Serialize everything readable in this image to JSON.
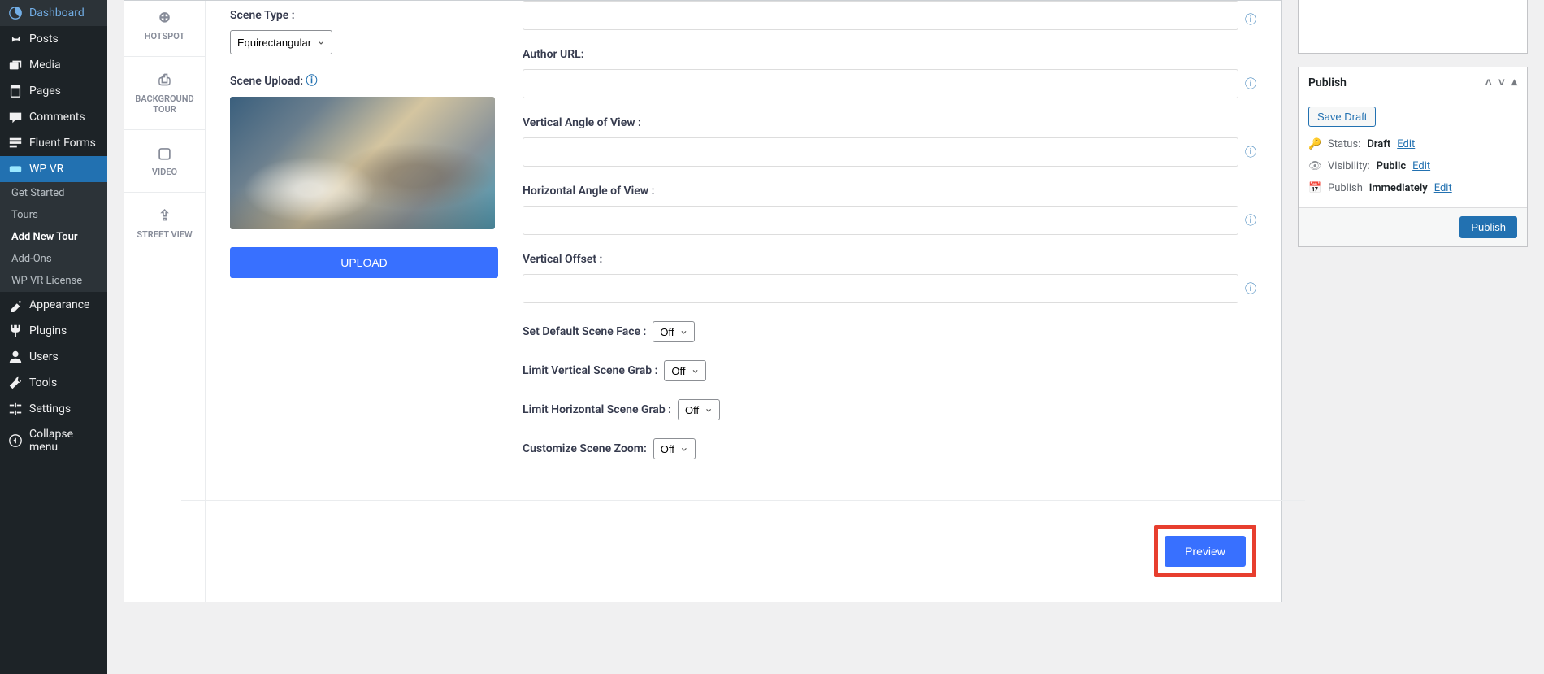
{
  "sidebar": {
    "items": [
      {
        "label": "Dashboard",
        "icon": "◉"
      },
      {
        "label": "Posts",
        "icon": "📌"
      },
      {
        "label": "Media",
        "icon": "🖼"
      },
      {
        "label": "Pages",
        "icon": "▤"
      },
      {
        "label": "Comments",
        "icon": "💬"
      },
      {
        "label": "Fluent Forms",
        "icon": "▦"
      },
      {
        "label": "WP VR",
        "icon": "◑"
      }
    ],
    "submenu": [
      {
        "label": "Get Started"
      },
      {
        "label": "Tours"
      },
      {
        "label": "Add New Tour"
      },
      {
        "label": "Add-Ons"
      },
      {
        "label": "WP VR License"
      }
    ],
    "lower": [
      {
        "label": "Appearance",
        "icon": "✎"
      },
      {
        "label": "Plugins",
        "icon": "🔌"
      },
      {
        "label": "Users",
        "icon": "👤"
      },
      {
        "label": "Tools",
        "icon": "🔧"
      },
      {
        "label": "Settings",
        "icon": "▦"
      },
      {
        "label": "Collapse menu",
        "icon": "◀"
      }
    ]
  },
  "tabs": [
    {
      "label": "HOTSPOT",
      "icon": "⊕"
    },
    {
      "label": "BACKGROUND TOUR",
      "icon": "⎙"
    },
    {
      "label": "VIDEO",
      "icon": "▷"
    },
    {
      "label": "STREET VIEW",
      "icon": "⇪"
    }
  ],
  "form": {
    "scene_type_label": "Scene Type :",
    "scene_type_value": "Equirectangular",
    "scene_upload_label": "Scene Upload:",
    "upload_btn": "UPLOAD",
    "author_url_label": "Author URL:",
    "vaov_label": "Vertical Angle of View :",
    "haov_label": "Horizontal Angle of View :",
    "voffset_label": "Vertical Offset :",
    "default_face_label": "Set Default Scene Face :",
    "limit_v_label": "Limit Vertical Scene Grab :",
    "limit_h_label": "Limit Horizontal Scene Grab :",
    "zoom_label": "Customize Scene Zoom:",
    "off_value": "Off",
    "preview_btn": "Preview"
  },
  "publish": {
    "title": "Publish",
    "save_draft": "Save Draft",
    "status_label": "Status:",
    "status_value": "Draft",
    "visibility_label": "Visibility:",
    "visibility_value": "Public",
    "publish_label": "Publish",
    "immediately": "immediately",
    "edit": "Edit",
    "publish_btn": "Publish"
  }
}
